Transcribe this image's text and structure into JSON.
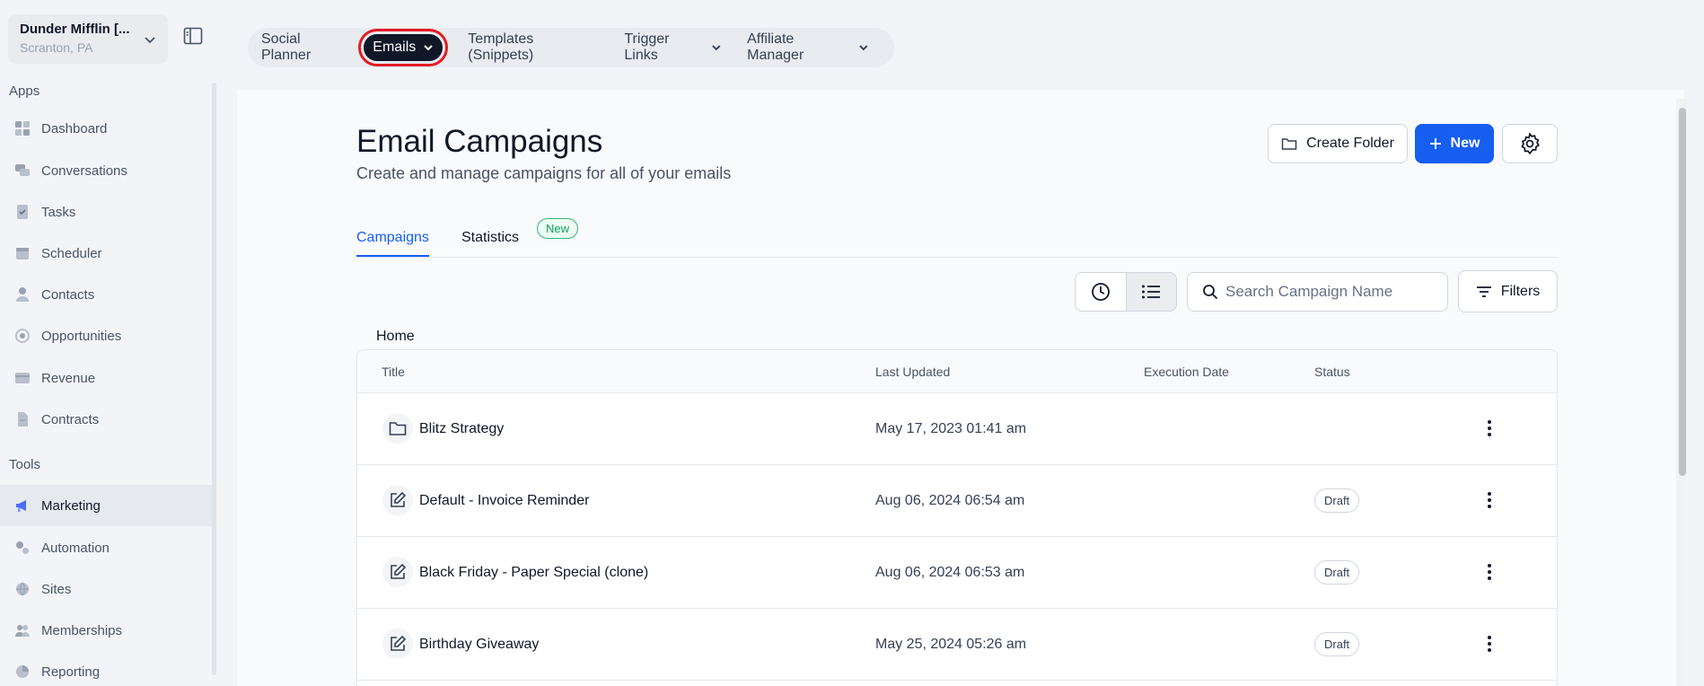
{
  "account": {
    "name": "Dunder Mifflin [...",
    "location": "Scranton, PA"
  },
  "sidebar": {
    "apps_label": "Apps",
    "tools_label": "Tools",
    "apps": [
      {
        "label": "Dashboard",
        "icon": "dashboard-icon"
      },
      {
        "label": "Conversations",
        "icon": "chat-icon"
      },
      {
        "label": "Tasks",
        "icon": "tasks-icon"
      },
      {
        "label": "Scheduler",
        "icon": "calendar-icon"
      },
      {
        "label": "Contacts",
        "icon": "person-icon"
      },
      {
        "label": "Opportunities",
        "icon": "target-icon"
      },
      {
        "label": "Revenue",
        "icon": "card-icon"
      },
      {
        "label": "Contracts",
        "icon": "document-icon"
      }
    ],
    "tools": [
      {
        "label": "Marketing",
        "icon": "megaphone-icon",
        "active": true
      },
      {
        "label": "Automation",
        "icon": "gears-icon"
      },
      {
        "label": "Sites",
        "icon": "globe-icon"
      },
      {
        "label": "Memberships",
        "icon": "people-icon"
      },
      {
        "label": "Reporting",
        "icon": "pie-icon"
      }
    ]
  },
  "topnav": {
    "items": [
      {
        "label": "Social Planner"
      },
      {
        "label": "Emails",
        "active": true,
        "dropdown": true
      },
      {
        "label": "Templates (Snippets)"
      },
      {
        "label": "Trigger Links",
        "dropdown": true
      },
      {
        "label": "Affiliate Manager",
        "dropdown": true
      }
    ]
  },
  "page": {
    "title": "Email Campaigns",
    "subtitle": "Create and manage campaigns for all of your emails",
    "create_folder": "Create Folder",
    "new": "New",
    "tabs": [
      {
        "label": "Campaigns",
        "active": true
      },
      {
        "label": "Statistics"
      }
    ],
    "new_badge": "New",
    "search_placeholder": "Search Campaign Name",
    "filters": "Filters",
    "breadcrumb": "Home"
  },
  "table": {
    "headers": [
      "Title",
      "Last Updated",
      "Execution Date",
      "Status"
    ],
    "rows": [
      {
        "type": "folder",
        "title": "Blitz Strategy",
        "updated": "May 17, 2023 01:41 am",
        "status": ""
      },
      {
        "type": "email",
        "title": "Default - Invoice Reminder",
        "updated": "Aug 06, 2024 06:54 am",
        "status": "Draft"
      },
      {
        "type": "email",
        "title": "Black Friday - Paper Special (clone)",
        "updated": "Aug 06, 2024 06:53 am",
        "status": "Draft"
      },
      {
        "type": "email",
        "title": "Birthday Giveaway",
        "updated": "May 25, 2024 05:26 am",
        "status": "Draft"
      }
    ]
  },
  "colors": {
    "accent": "#155eef",
    "highlight": "#e21b24",
    "active_pill": "#101828"
  }
}
